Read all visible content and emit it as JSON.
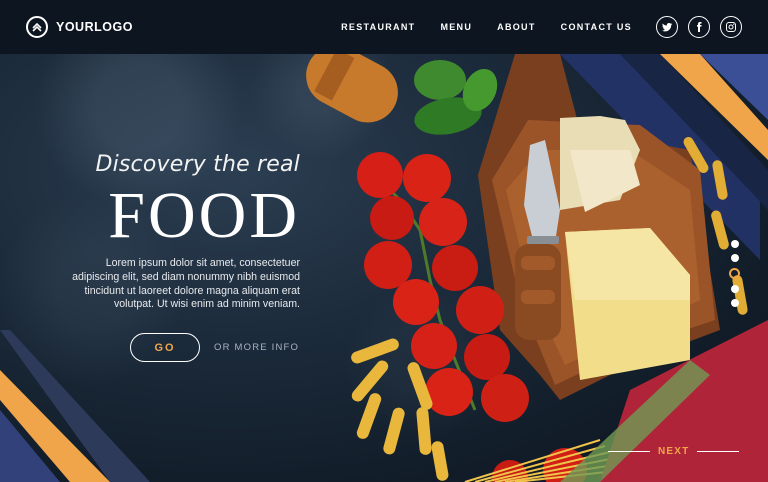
{
  "header": {
    "logo_text": "YOURLOGO",
    "nav": [
      "RESTAURANT",
      "MENU",
      "ABOUT",
      "CONTACT US"
    ],
    "socials": [
      {
        "name": "twitter-icon",
        "glyph": "t"
      },
      {
        "name": "facebook-icon",
        "glyph": "f"
      },
      {
        "name": "instagram-icon",
        "glyph": "◎"
      }
    ]
  },
  "hero": {
    "tagline": "Discovery the real",
    "headline": "FOOD",
    "lead": "Lorem ipsum dolor sit amet, consectetuer adipiscing elit, sed diam nonummy nibh euismod tincidunt ut laoreet dolore magna aliquam erat volutpat. Ut wisi enim ad minim veniam.",
    "go_label": "GO",
    "more_label": "OR MORE INFO"
  },
  "slider": {
    "total": 5,
    "active_index": 2
  },
  "next_label": "NEXT",
  "colors": {
    "accent": "#f1a54a",
    "header_bg": "#0c1520",
    "stripe_blue": "#2a3d8f"
  }
}
